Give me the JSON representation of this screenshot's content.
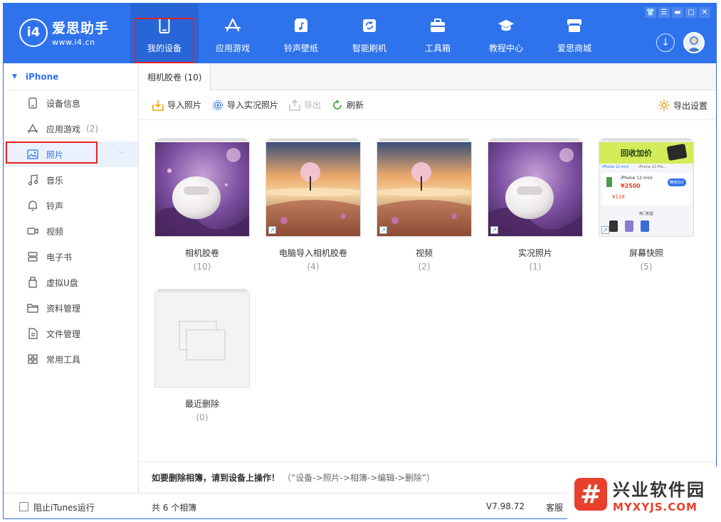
{
  "app": {
    "name": "爱思助手",
    "url": "www.i4.cn",
    "logo_mark": "i4"
  },
  "nav": [
    {
      "label": "我的设备",
      "icon": "phone-icon",
      "active": true
    },
    {
      "label": "应用游戏",
      "icon": "app-store-icon",
      "active": false
    },
    {
      "label": "铃声壁纸",
      "icon": "music-wallpaper-icon",
      "active": false
    },
    {
      "label": "智能刷机",
      "icon": "flash-icon",
      "active": false
    },
    {
      "label": "工具箱",
      "icon": "toolbox-icon",
      "active": false
    },
    {
      "label": "教程中心",
      "icon": "graduation-cap-icon",
      "active": false
    },
    {
      "label": "爱思商城",
      "icon": "shop-icon",
      "active": false
    }
  ],
  "sidebar": {
    "device": "iPhone",
    "items": [
      {
        "label": "设备信息",
        "count": "",
        "icon": "device-info-icon"
      },
      {
        "label": "应用游戏",
        "count": "(2)",
        "icon": "apps-icon"
      },
      {
        "label": "照片",
        "count": "",
        "icon": "photo-icon",
        "active": true
      },
      {
        "label": "音乐",
        "count": "",
        "icon": "music-note-icon"
      },
      {
        "label": "铃声",
        "count": "",
        "icon": "bell-icon"
      },
      {
        "label": "视频",
        "count": "",
        "icon": "video-icon"
      },
      {
        "label": "电子书",
        "count": "",
        "icon": "ebook-icon"
      },
      {
        "label": "虚拟U盘",
        "count": "",
        "icon": "usb-drive-icon"
      },
      {
        "label": "资料管理",
        "count": "",
        "icon": "folder-icon"
      },
      {
        "label": "文件管理",
        "count": "",
        "icon": "file-icon"
      },
      {
        "label": "常用工具",
        "count": "",
        "icon": "grid-tools-icon"
      }
    ]
  },
  "tab": {
    "label": "相机胶卷 (10)"
  },
  "toolbar": {
    "import_photos": "导入照片",
    "import_live": "导入实况照片",
    "export": "导出",
    "refresh": "刷新",
    "export_settings": "导出设置"
  },
  "albums": [
    {
      "name": "相机胶卷",
      "count": "(10)",
      "thumb": "earbuds",
      "shortcut": false
    },
    {
      "name": "电脑导入相机胶卷",
      "count": "(4)",
      "thumb": "sunset-tree",
      "shortcut": true
    },
    {
      "name": "视频",
      "count": "(2)",
      "thumb": "sunset-tree",
      "shortcut": true
    },
    {
      "name": "实况照片",
      "count": "(1)",
      "thumb": "earbuds",
      "shortcut": true
    },
    {
      "name": "屏幕快照",
      "count": "(5)",
      "thumb": "screenshot",
      "shortcut": true
    },
    {
      "name": "最近删除",
      "count": "(0)",
      "thumb": "empty",
      "shortcut": false
    }
  ],
  "screenshot_thumb": {
    "banner": "回收加价",
    "tab1": "iPhone 12 mini",
    "tab2": "iPhone 12 Pro...",
    "model": "iPhone 12 mini",
    "price": "¥2500",
    "button": "精准估价",
    "bonus": "¥118",
    "hot": "热门机型"
  },
  "footer": {
    "note": "如要删除相簿，请到设备上操作！",
    "hint": "（“设备->照片->相簿->编辑->删除”）"
  },
  "statusbar": {
    "itunes_label": "阻止iTunes运行",
    "album_count": "共 6 个相簿",
    "version": "V7.98.72",
    "service": "客服"
  },
  "watermark": {
    "mark": "#",
    "title": "兴业软件园",
    "url": "MYXYJS.COM"
  },
  "colors": {
    "brand_blue": "#2f73ec",
    "highlight_red": "#e5211d"
  }
}
